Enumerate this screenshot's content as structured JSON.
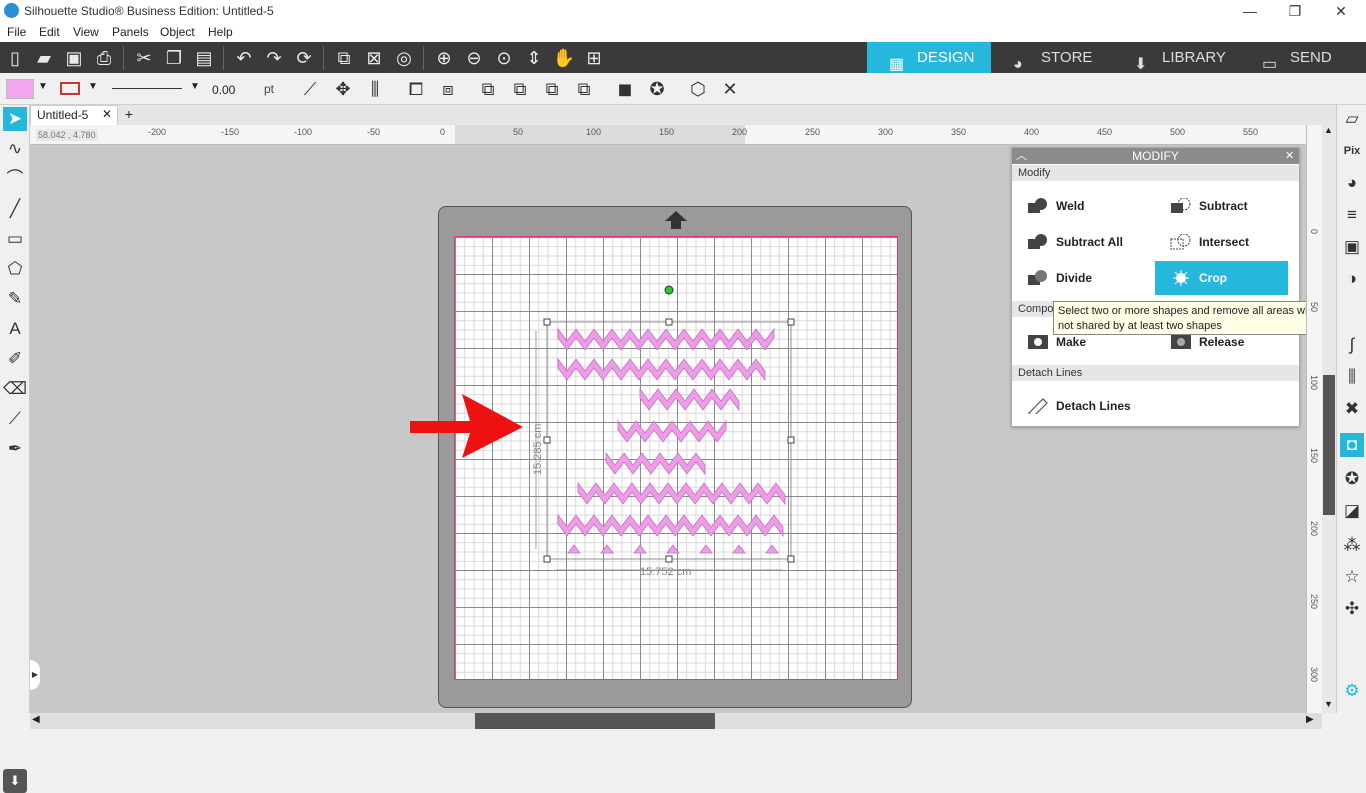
{
  "window": {
    "title": "Silhouette Studio® Business Edition: Untitled-5",
    "minimize": "—",
    "restore": "❐",
    "close": "✕"
  },
  "menu": [
    "File",
    "Edit",
    "View",
    "Panels",
    "Object",
    "Help"
  ],
  "nav_tabs": [
    {
      "label": "DESIGN",
      "active": true
    },
    {
      "label": "STORE",
      "active": false
    },
    {
      "label": "LIBRARY",
      "active": false
    },
    {
      "label": "SEND",
      "active": false
    }
  ],
  "toolbar2": {
    "line_width_value": "0.00",
    "line_width_unit": "pt"
  },
  "document_tab": {
    "name": "Untitled-5",
    "close": "✕",
    "add": "+"
  },
  "coordinates": "58.042 , 4.780",
  "ruler_h": [
    "-200",
    "-150",
    "-100",
    "-50",
    "0",
    "50",
    "100",
    "150",
    "200",
    "250",
    "300",
    "350",
    "400",
    "450",
    "500",
    "550"
  ],
  "ruler_v": [
    "0",
    "50",
    "100",
    "150",
    "200",
    "250",
    "300"
  ],
  "selection": {
    "height_label": "15.285 cm",
    "width_label": "15.752 cm"
  },
  "modify_panel": {
    "title": "MODIFY",
    "close": "✕",
    "modify_section": "Modify",
    "buttons": {
      "weld": "Weld",
      "subtract": "Subtract",
      "subtract_all": "Subtract All",
      "intersect": "Intersect",
      "divide": "Divide",
      "crop": "Crop"
    },
    "compound_section": "Compou",
    "make": "Make",
    "release": "Release",
    "detach_section": "Detach Lines",
    "detach": "Detach Lines"
  },
  "tooltip": {
    "line1": "Select two or more shapes and remove all areas which are",
    "line2": "not shared by at least two shapes"
  },
  "colors": {
    "accent": "#26b7dd",
    "fill_swatch": "#f2a6f0",
    "zigzag": "#ee9ce8",
    "arrow": "#ee1111",
    "toolbar_dark": "#3a3a3a"
  }
}
